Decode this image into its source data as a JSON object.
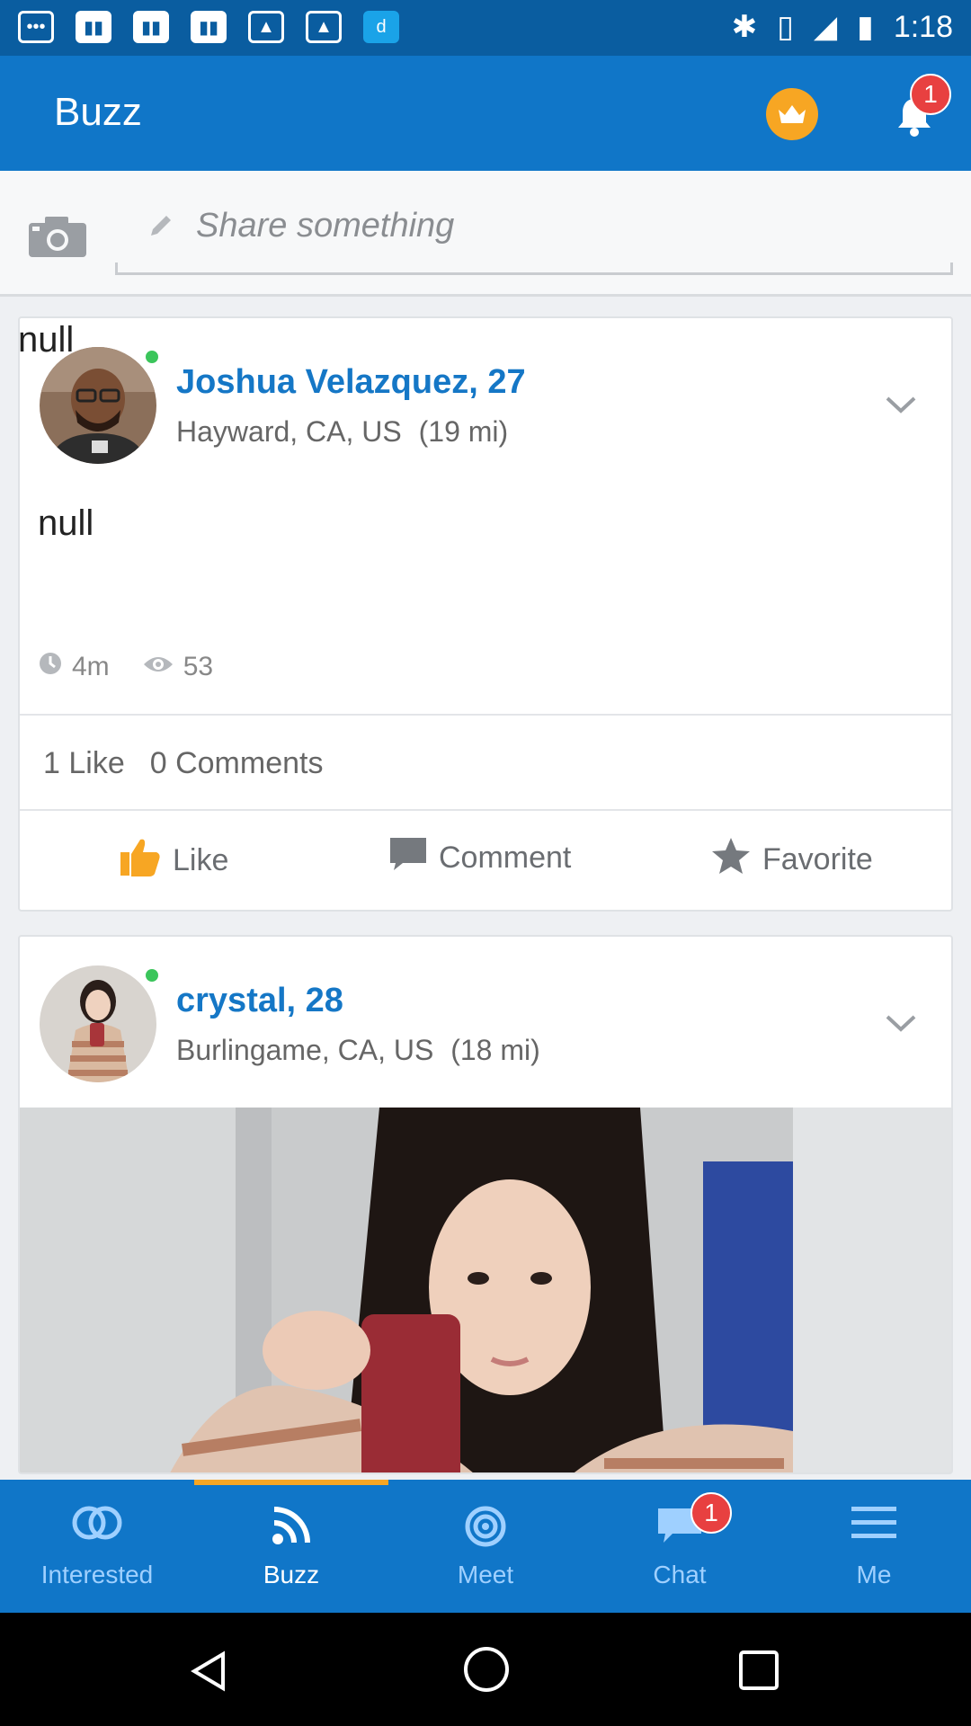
{
  "status_bar": {
    "time": "1:18"
  },
  "app_bar": {
    "title": "Buzz",
    "notification_count": "1"
  },
  "share": {
    "placeholder": "Share something"
  },
  "posts": [
    {
      "top_text": "null",
      "name": "Joshua Velazquez, 27",
      "location": "Hayward, CA, US",
      "distance": "(19 mi)",
      "text": "null",
      "age": "4m",
      "views": "53",
      "likes": "1 Like",
      "comments": "0 Comments",
      "actions": {
        "like": "Like",
        "comment": "Comment",
        "favorite": "Favorite"
      }
    },
    {
      "name": "crystal, 28",
      "location": "Burlingame, CA, US",
      "distance": "(18 mi)"
    }
  ],
  "bottom_nav": {
    "items": [
      {
        "label": "Interested"
      },
      {
        "label": "Buzz"
      },
      {
        "label": "Meet"
      },
      {
        "label": "Chat",
        "badge": "1"
      },
      {
        "label": "Me"
      }
    ]
  },
  "colors": {
    "primary": "#1076c8",
    "accent": "#f7a623",
    "badge": "#e84040",
    "name": "#1577c6"
  }
}
